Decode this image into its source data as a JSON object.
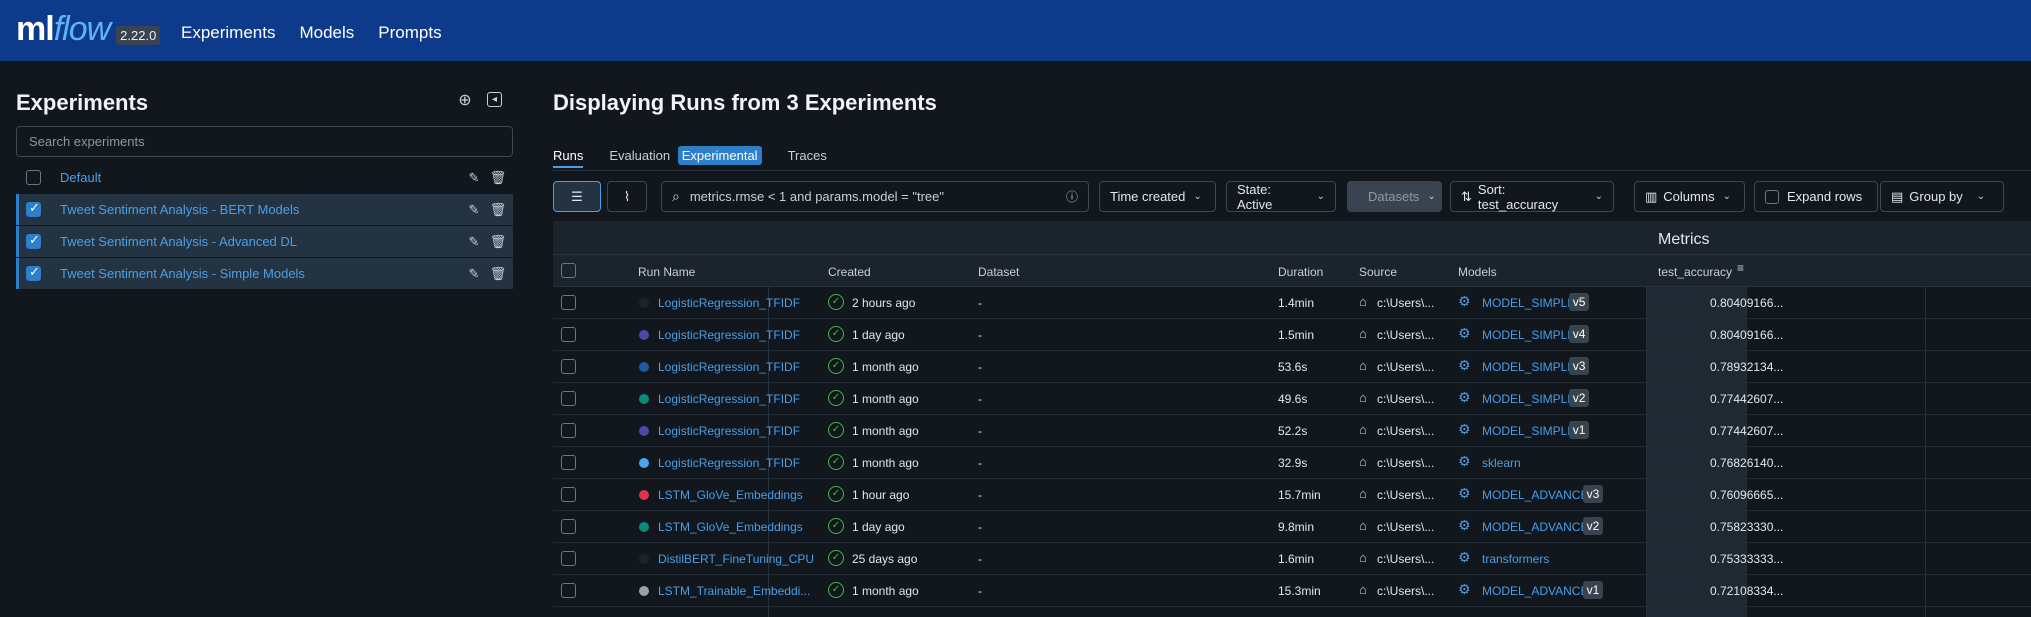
{
  "app": {
    "logo_ml": "ml",
    "logo_flow": "flow",
    "version": "2.22.0"
  },
  "nav": [
    "Experiments",
    "Models",
    "Prompts"
  ],
  "sidebar": {
    "title": "Experiments",
    "search_placeholder": "Search experiments",
    "experiments": [
      {
        "name": "Default",
        "checked": false
      },
      {
        "name": "Tweet Sentiment Analysis - BERT Models",
        "checked": true
      },
      {
        "name": "Tweet Sentiment Analysis - Advanced DL",
        "checked": true
      },
      {
        "name": "Tweet Sentiment Analysis - Simple Models",
        "checked": true
      }
    ]
  },
  "main": {
    "title": "Displaying Runs from 3 Experiments",
    "tabs": {
      "runs": "Runs",
      "evaluation": "Evaluation",
      "experimental": "Experimental",
      "traces": "Traces"
    },
    "search_value": "metrics.rmse < 1 and params.model = \"tree\"",
    "toolbar": {
      "time_created": "Time created",
      "state": "State: Active",
      "datasets": "Datasets",
      "sort": "Sort: test_accuracy",
      "columns": "Columns",
      "expand_rows": "Expand rows",
      "group_by": "Group by"
    },
    "table": {
      "group_header": "Metrics",
      "headers": {
        "run_name": "Run Name",
        "created": "Created",
        "dataset": "Dataset",
        "duration": "Duration",
        "source": "Source",
        "models": "Models",
        "metric": "test_accuracy"
      },
      "rows": [
        {
          "name": "LogisticRegression_TFIDF",
          "color": "#1c232b",
          "created": "2 hours ago",
          "dataset": "-",
          "duration": "1.4min",
          "source": "c:\\Users\\...",
          "model": "MODEL_SIMPLE",
          "version": "v5",
          "metric": "0.80409166..."
        },
        {
          "name": "LogisticRegression_TFIDF",
          "color": "#4a4ba5",
          "created": "1 day ago",
          "dataset": "-",
          "duration": "1.5min",
          "source": "c:\\Users\\...",
          "model": "MODEL_SIMPLE",
          "version": "v4",
          "metric": "0.80409166..."
        },
        {
          "name": "LogisticRegression_TFIDF",
          "color": "#1d5b9e",
          "created": "1 month ago",
          "dataset": "-",
          "duration": "53.6s",
          "source": "c:\\Users\\...",
          "model": "MODEL_SIMPLE",
          "version": "v3",
          "metric": "0.78932134..."
        },
        {
          "name": "LogisticRegression_TFIDF",
          "color": "#0f8a78",
          "created": "1 month ago",
          "dataset": "-",
          "duration": "49.6s",
          "source": "c:\\Users\\...",
          "model": "MODEL_SIMPLE",
          "version": "v2",
          "metric": "0.77442607..."
        },
        {
          "name": "LogisticRegression_TFIDF",
          "color": "#4a4ba5",
          "created": "1 month ago",
          "dataset": "-",
          "duration": "52.2s",
          "source": "c:\\Users\\...",
          "model": "MODEL_SIMPLE",
          "version": "v1",
          "metric": "0.77442607..."
        },
        {
          "name": "LogisticRegression_TFIDF",
          "color": "#4ba4ef",
          "created": "1 month ago",
          "dataset": "-",
          "duration": "32.9s",
          "source": "c:\\Users\\...",
          "model": "sklearn",
          "version": "",
          "metric": "0.76826140..."
        },
        {
          "name": "LSTM_GloVe_Embeddings",
          "color": "#e0334f",
          "created": "1 hour ago",
          "dataset": "-",
          "duration": "15.7min",
          "source": "c:\\Users\\...",
          "model": "MODEL_ADVANCED",
          "version": "v3",
          "metric": "0.76096665..."
        },
        {
          "name": "LSTM_GloVe_Embeddings",
          "color": "#0f8a78",
          "created": "1 day ago",
          "dataset": "-",
          "duration": "9.8min",
          "source": "c:\\Users\\...",
          "model": "MODEL_ADVANCED",
          "version": "v2",
          "metric": "0.75823330..."
        },
        {
          "name": "DistilBERT_FineTuning_CPU",
          "color": "#1c232b",
          "created": "25 days ago",
          "dataset": "-",
          "duration": "1.6min",
          "source": "c:\\Users\\...",
          "model": "transformers",
          "version": "",
          "metric": "0.75333333..."
        },
        {
          "name": "LSTM_Trainable_Embeddi...",
          "color": "#9aa1aa",
          "created": "1 month ago",
          "dataset": "-",
          "duration": "15.3min",
          "source": "c:\\Users\\...",
          "model": "MODEL_ADVANCED",
          "version": "v1",
          "metric": "0.72108334..."
        }
      ]
    }
  },
  "icons": {
    "create": "plus-circle-icon",
    "collapse": "collapse-sidebar-icon",
    "edit": "pencil-icon",
    "delete": "trash-icon",
    "list_view": "list-icon",
    "chart_view": "chart-icon",
    "search": "search-icon",
    "info": "info-icon",
    "sort": "sort-icon",
    "columns": "columns-icon",
    "group": "group-icon",
    "status": "check-circle-icon",
    "source": "home-icon",
    "model": "model-icon"
  }
}
